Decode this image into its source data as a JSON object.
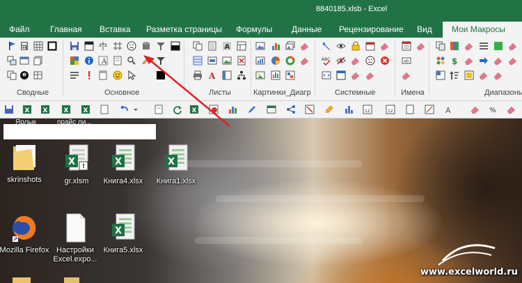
{
  "window": {
    "title": "8840185.xlsb - Excel"
  },
  "tabs": [
    {
      "label": "Файл"
    },
    {
      "label": "Главная"
    },
    {
      "label": "Вставка"
    },
    {
      "label": "Разметка страницы"
    },
    {
      "label": "Формулы"
    },
    {
      "label": "Данные"
    },
    {
      "label": "Рецензирование"
    },
    {
      "label": "Вид"
    },
    {
      "label": "Мои Макросы",
      "active": true
    }
  ],
  "ribbon": {
    "groups": [
      {
        "label": "Сводные"
      },
      {
        "label": "Основное"
      },
      {
        "label": "Листы"
      },
      {
        "label": "Картинки_Диагр"
      },
      {
        "label": "Системные"
      },
      {
        "label": "Имена"
      },
      {
        "label": "Диапазоны"
      }
    ]
  },
  "desktop": {
    "hidden_labels": [
      "Ярлык",
      "прайс ли..."
    ],
    "icons": [
      {
        "label": "skrinshots",
        "type": "folder"
      },
      {
        "label": "gr.xlsm",
        "type": "excel-macro"
      },
      {
        "label": "Книга4.xlsx",
        "type": "excel"
      },
      {
        "label": "Книга1.xlsx",
        "type": "excel"
      },
      {
        "label": "Mozilla Firefox",
        "type": "firefox"
      },
      {
        "label": "Настройки Excel.expo...",
        "type": "file"
      },
      {
        "label": "Книга5.xlsx",
        "type": "excel"
      }
    ],
    "watermark": "www.excelworld.ru"
  },
  "colors": {
    "excel_green": "#217346",
    "ribbon_bg": "#f3f3f3",
    "arrow_red": "#e02020"
  }
}
